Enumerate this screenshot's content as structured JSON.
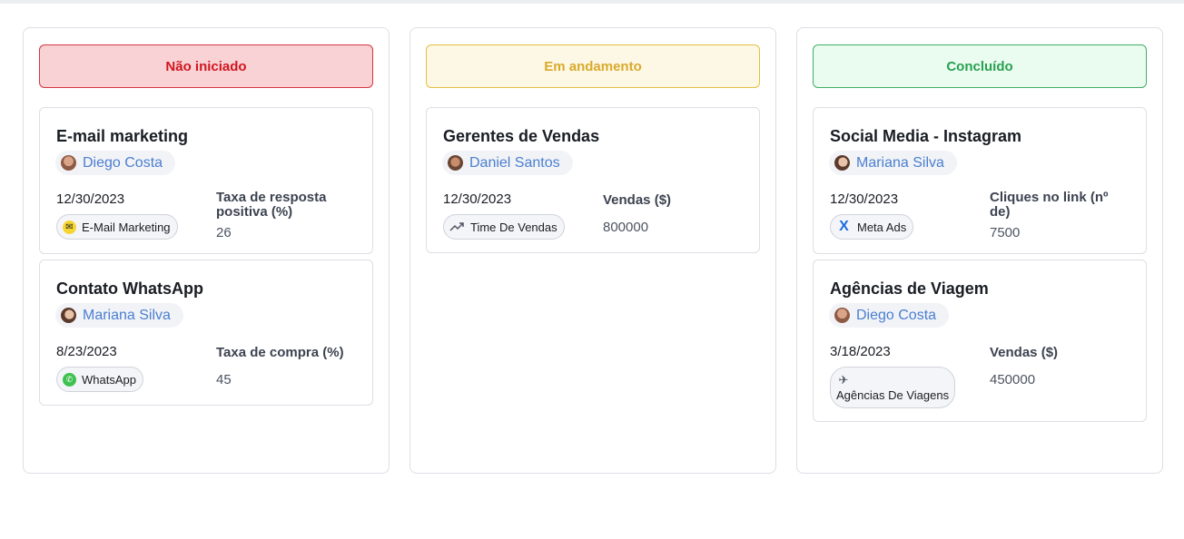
{
  "columns": [
    {
      "title": "Não iniciado",
      "cards": [
        {
          "title": "E-mail marketing",
          "user": "Diego Costa",
          "date": "12/30/2023",
          "tag": "E-Mail Marketing",
          "tag_icon": "mailchimp-icon",
          "metric_label": "Taxa de resposta positiva (%)",
          "metric_value": "26"
        },
        {
          "title": "Contato WhatsApp",
          "user": "Mariana Silva",
          "date": "8/23/2023",
          "tag": "WhatsApp",
          "tag_icon": "whatsapp-icon",
          "metric_label": "Taxa de compra (%)",
          "metric_value": "45"
        }
      ]
    },
    {
      "title": "Em andamento",
      "cards": [
        {
          "title": "Gerentes de Vendas",
          "user": "Daniel Santos",
          "date": "12/30/2023",
          "tag": "Time De Vendas",
          "tag_icon": "trending-up-icon",
          "metric_label": "Vendas ($)",
          "metric_value": "800000"
        }
      ]
    },
    {
      "title": "Concluído",
      "cards": [
        {
          "title": "Social Media - Instagram",
          "user": "Mariana Silva",
          "date": "12/30/2023",
          "tag": "Meta Ads",
          "tag_icon": "meta-icon",
          "metric_label": "Cliques no link (nº de)",
          "metric_value": "7500"
        },
        {
          "title": "Agências de Viagem",
          "user": "Diego Costa",
          "date": "3/18/2023",
          "tag": "Agências De Viagens",
          "tag_icon": "airplane-icon",
          "metric_label": "Vendas ($)",
          "metric_value": "450000"
        }
      ]
    }
  ],
  "colors": {
    "not_started": "#d0161f",
    "in_progress": "#d9aa2a",
    "done": "#27a050",
    "user_link": "#4a7fd0"
  }
}
